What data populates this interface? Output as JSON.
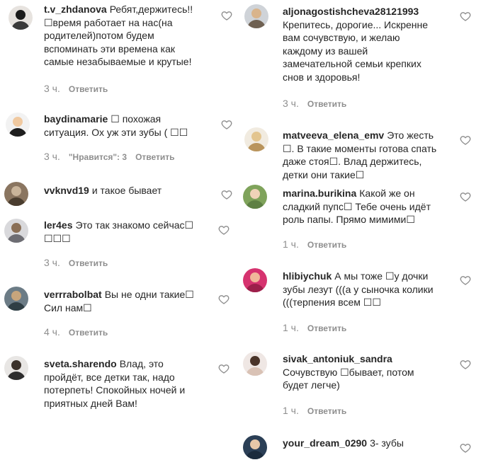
{
  "left": [
    {
      "username": "t.v_zhdanova",
      "lines": [
        "Ребят,держитесь!!",
        "☐время работает на нас(на",
        "родителей)потом будем",
        "вспоминать эти времена как",
        "самые незабываемые и крутые!"
      ],
      "time": "3 ч.",
      "likes": "",
      "reply": "Ответить",
      "avatar_colors": [
        "#e7e3df",
        "#1c1c1c",
        "#3a3a3a"
      ]
    },
    {
      "username": "baydinamarie",
      "lines": [
        "☐ похожая",
        "ситуация. Ох уж эти зубы ( ☐☐"
      ],
      "time": "3 ч.",
      "likes": "\"Нравится\": 3",
      "reply": "Ответить",
      "avatar_colors": [
        "#f2f2f2",
        "#f0c9a0",
        "#1e1e1e"
      ]
    },
    {
      "username": "vvknvd19",
      "lines": [
        "и такое бывает"
      ],
      "time": "",
      "likes": "",
      "reply": "",
      "avatar_colors": [
        "#8a7560",
        "#c9b49a",
        "#4a3d2f"
      ]
    },
    {
      "username": "ler4es",
      "lines": [
        "Это так знакомо сейчас☐",
        "☐☐☐"
      ],
      "time": "3 ч.",
      "likes": "",
      "reply": "Ответить",
      "avatar_colors": [
        "#d9d9dc",
        "#8a6f56",
        "#6d6d73"
      ]
    },
    {
      "username": "verrrabolbat",
      "lines": [
        "Вы не одни такие☐",
        "Сил нам☐"
      ],
      "time": "4 ч.",
      "likes": "",
      "reply": "Ответить",
      "avatar_colors": [
        "#6c7c86",
        "#c7a57c",
        "#2f3e44"
      ]
    },
    {
      "username": "sveta.sharendo",
      "lines": [
        "Влад, это",
        "пройдёт, все детки так, надо",
        "потерпеть! Спокойных ночей и",
        "приятных дней Вам!"
      ],
      "time": "",
      "likes": "",
      "reply": "",
      "avatar_colors": [
        "#e8e6e4",
        "#3b322b",
        "#2d2d2d"
      ]
    }
  ],
  "right": [
    {
      "username": "aljonagostishcheva28121993",
      "lines": [
        "Крепитесь, дорогие... Искренне",
        "вам сочувствую, и желаю",
        "каждому из вашей",
        "замечательной семьи крепких",
        "снов и здоровья!"
      ],
      "time": "3 ч.",
      "likes": "",
      "reply": "Ответить",
      "avatar_colors": [
        "#cfd3d8",
        "#d9b48c",
        "#6f6152"
      ]
    },
    {
      "username": "matveeva_elena_emv",
      "lines": [
        "Это жесть",
        "☐. В такие моменты готова спать",
        "даже стоя☐. Влад держитесь,",
        "детки они такие☐"
      ],
      "time": "",
      "likes": "",
      "reply": "",
      "avatar_colors": [
        "#f1ebe0",
        "#e3c58f",
        "#b9945c"
      ]
    },
    {
      "username": "marina.burikina",
      "lines": [
        "Какой же он",
        "сладкий пупс☐ Тебе очень идёт",
        "роль папы. Прямо мимими☐"
      ],
      "time": "1 ч.",
      "likes": "",
      "reply": "Ответить",
      "avatar_colors": [
        "#7fa35b",
        "#efd3b8",
        "#5e8044"
      ]
    },
    {
      "username": "hlibiychuk",
      "lines": [
        "А мы тоже ☐у дочки",
        "зубы лезут (((а у сыночка колики",
        "(((терпения всем ☐☐"
      ],
      "time": "1 ч.",
      "likes": "",
      "reply": "Ответить",
      "avatar_colors": [
        "#d6336f",
        "#f0b89a",
        "#9c1f4a"
      ]
    },
    {
      "username": "sivak_antoniuk_sandra",
      "lines": [
        "",
        "Сочувствую ☐бывает, потом",
        "будет легче)"
      ],
      "time": "1 ч.",
      "likes": "",
      "reply": "Ответить",
      "avatar_colors": [
        "#efe7e4",
        "#4a3429",
        "#d9c2b5"
      ]
    },
    {
      "username": "your_dream_0290",
      "lines": [
        "3- зубы"
      ],
      "time": "",
      "likes": "",
      "reply": "",
      "avatar_colors": [
        "#2b3f56",
        "#e6c7a8",
        "#1b2b3d"
      ]
    }
  ],
  "icon": "heart-outline-icon",
  "colors": {
    "text": "#262626",
    "meta": "#8e8e8e",
    "heart": "#8e8e8e"
  }
}
